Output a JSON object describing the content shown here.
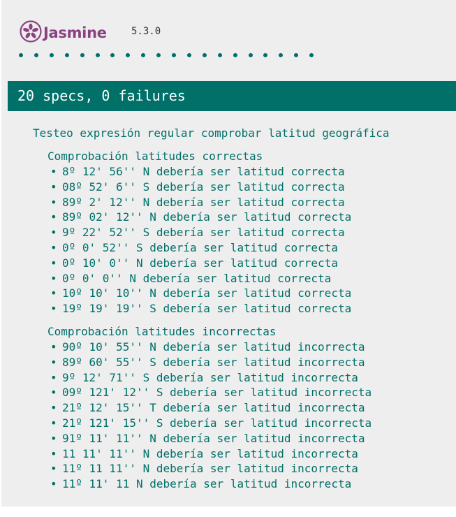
{
  "header": {
    "logo_text": "Jasmine",
    "version": "5.3.0",
    "spec_dot_count": 20
  },
  "summary": {
    "text": "20 specs, 0 failures"
  },
  "suite": {
    "title": "Testeo expresión regular comprobar latitud geográfica",
    "subsuites": [
      {
        "title": "Comprobación latitudes correctas",
        "specs": [
          "8º 12' 56'' N debería ser latitud correcta",
          "08º 52' 6'' S debería ser latitud correcta",
          "89º 2' 12'' N debería ser latitud correcta",
          "89º 02' 12'' N debería ser latitud correcta",
          "9º 22' 52'' S debería ser latitud correcta",
          "0º 0' 52'' S debería ser latitud correcta",
          "0º 10' 0'' N debería ser latitud correcta",
          "0º 0' 0'' N debería ser latitud correcta",
          "10º 10' 10'' N debería ser latitud correcta",
          "19º 19' 19'' S debería ser latitud correcta"
        ]
      },
      {
        "title": "Comprobación latitudes incorrectas",
        "specs": [
          "90º 10' 55'' N debería ser latitud incorrecta",
          "89º 60' 55'' S debería ser latitud incorrecta",
          "9º 12' 71'' S debería ser latitud incorrecta",
          "09º 121' 12'' S debería ser latitud incorrecta",
          "21º 12' 15'' T debería ser latitud incorrecta",
          "21º 121' 15'' S debería ser latitud incorrecta",
          "91º 11' 11'' N debería ser latitud incorrecta",
          "11 11' 11'' N debería ser latitud incorrecta",
          "11º 11 11'' N debería ser latitud incorrecta",
          "11º 11' 11 N debería ser latitud incorrecta"
        ]
      }
    ]
  },
  "colors": {
    "brand": "#8a4182",
    "passed": "#007069",
    "background": "#eeeeee"
  },
  "icons": {
    "logo": "jasmine-flower-icon",
    "spec_status": "passed-dot-icon"
  }
}
